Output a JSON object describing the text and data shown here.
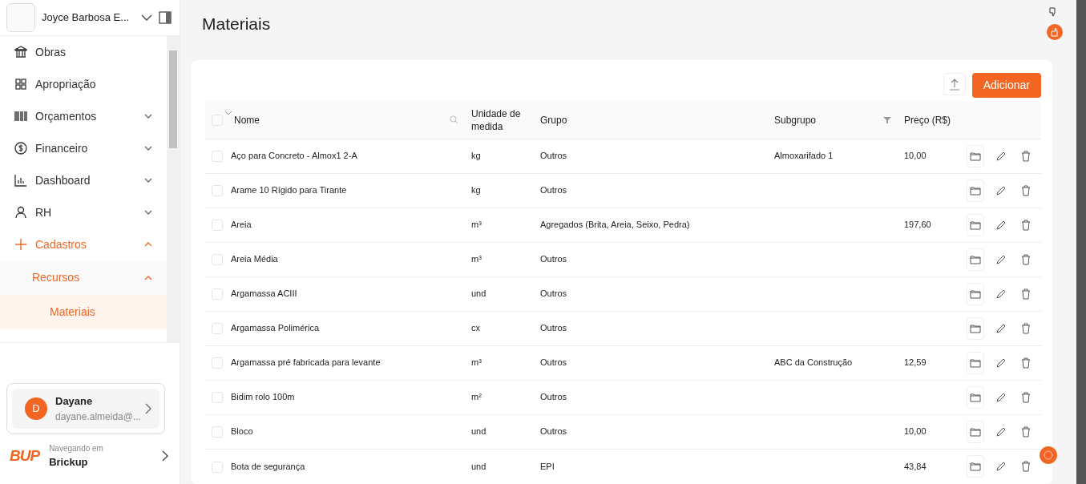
{
  "org": {
    "name": "Joyce Barbosa E..."
  },
  "menu": [
    {
      "label": "Obras",
      "selected": false
    },
    {
      "label": "Apropriação",
      "selected": false
    },
    {
      "label": "Orçamentos",
      "selected": false,
      "expanded": false
    },
    {
      "label": "Financeiro",
      "selected": false,
      "expanded": false
    },
    {
      "label": "Dashboard",
      "selected": false,
      "expanded": false
    },
    {
      "label": "RH",
      "selected": false,
      "expanded": false
    },
    {
      "label": "Cadastros",
      "selected": true,
      "expanded": true,
      "children": [
        {
          "label": "Recursos",
          "selected": true,
          "expanded": true,
          "children": [
            {
              "label": "Materiais",
              "selected": true
            }
          ]
        }
      ]
    }
  ],
  "user": {
    "initial": "D",
    "name": "Dayane",
    "email": "dayane.almeida@..."
  },
  "workspace": {
    "logo": "BUP",
    "caption": "Navegando em",
    "name": "Brickup"
  },
  "page_title": "Materiais",
  "add_button": "Adicionar",
  "table": {
    "header_checked": false,
    "columns": [
      "Nome",
      "Unidade de medida",
      "Grupo",
      "Subgrupo",
      "Preço (R$)"
    ],
    "rows": [
      {
        "checked": false,
        "cells": [
          "Aço para Concreto - Almox1 2-A",
          "kg",
          "Outros",
          "Almoxarifado 1",
          "10,00"
        ]
      },
      {
        "checked": false,
        "cells": [
          "Arame 10 Rígido para Tirante",
          "kg",
          "Outros",
          "",
          ""
        ]
      },
      {
        "checked": false,
        "cells": [
          "Areia",
          "m³",
          "Agregados (Brita, Areia, Seixo, Pedra)",
          "",
          "197,60"
        ]
      },
      {
        "checked": false,
        "cells": [
          "Areia Média",
          "m³",
          "Outros",
          "",
          ""
        ]
      },
      {
        "checked": false,
        "cells": [
          "Argamassa ACIII",
          "und",
          "Outros",
          "",
          ""
        ]
      },
      {
        "checked": false,
        "cells": [
          "Argamassa Polimérica",
          "cx",
          "Outros",
          "",
          ""
        ]
      },
      {
        "checked": false,
        "cells": [
          "Argamassa pré fabricada para levante",
          "m³",
          "Outros",
          "ABC da Construção",
          "12,59"
        ]
      },
      {
        "checked": false,
        "cells": [
          "Bidim rolo 100m",
          "m²",
          "Outros",
          "",
          ""
        ]
      },
      {
        "checked": false,
        "cells": [
          "Bloco",
          "und",
          "Outros",
          "",
          "10,00"
        ]
      },
      {
        "checked": false,
        "cells": [
          "Bota de segurança",
          "und",
          "EPI",
          "",
          "43,84"
        ]
      }
    ]
  }
}
